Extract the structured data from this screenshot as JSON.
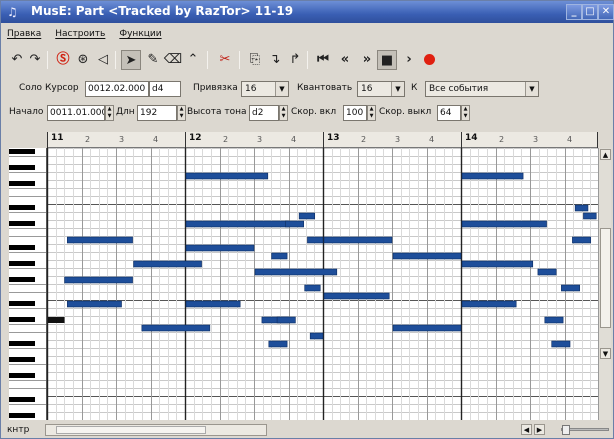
{
  "window": {
    "title": "MusE: Part <Tracked by RazTor> 11-19"
  },
  "menu": {
    "items": [
      "Правка",
      "Настроить",
      "Функции"
    ]
  },
  "toolbar": {
    "undo_icon": "undo-icon",
    "redo_icon": "redo-icon",
    "record_color": "#e02010"
  },
  "params": {
    "solo_label": "Соло",
    "cursor_label": "Курсор",
    "cursor_value": "0012.02.000",
    "cursor_note": "d4",
    "snap_label": "Привязка",
    "snap_value": "16",
    "quant_label": "Квантовать",
    "quant_value": "16",
    "k_label": "К",
    "events_value": "Все события",
    "start_label": "Начало",
    "start_value": "0011.01.000",
    "len_label": "Длн",
    "len_value": "192",
    "pitch_label": "Высота тона",
    "pitch_value": "d2",
    "velon_label": "Скор. вкл",
    "velon_value": "100",
    "veloff_label": "Скор. выкл",
    "veloff_value": "64"
  },
  "ruler": {
    "bars": [
      "11",
      "12",
      "13",
      "14",
      "1"
    ],
    "beats": [
      "2",
      "3",
      "4"
    ]
  },
  "notes": {
    "color": "#1e4e9a",
    "items": [
      {
        "t": 0.14,
        "d": 0.48,
        "p": 22
      },
      {
        "t": 0.62,
        "d": 0.5,
        "p": 19
      },
      {
        "t": 0.12,
        "d": 0.5,
        "p": 17
      },
      {
        "t": 0.14,
        "d": 0.4,
        "p": 14
      },
      {
        "t": 0.68,
        "d": 0.5,
        "p": 11
      },
      {
        "t": 1.0,
        "d": 0.6,
        "p": 30
      },
      {
        "t": 1.0,
        "d": 0.75,
        "p": 24
      },
      {
        "t": 1.0,
        "d": 0.5,
        "p": 21
      },
      {
        "t": 1.5,
        "d": 0.6,
        "p": 18
      },
      {
        "t": 1.0,
        "d": 0.4,
        "p": 14
      },
      {
        "t": 1.55,
        "d": 0.2,
        "p": 12
      },
      {
        "t": 1.6,
        "d": 0.14,
        "p": 9
      },
      {
        "t": 1.72,
        "d": 0.14,
        "p": 24
      },
      {
        "t": 1.82,
        "d": 0.12,
        "p": 25
      },
      {
        "t": 1.88,
        "d": 0.12,
        "p": 22
      },
      {
        "t": 1.62,
        "d": 0.12,
        "p": 20
      },
      {
        "t": 1.86,
        "d": 0.12,
        "p": 16
      },
      {
        "t": 1.66,
        "d": 0.14,
        "p": 12
      },
      {
        "t": 1.9,
        "d": 0.1,
        "p": 10
      },
      {
        "t": 2.0,
        "d": 0.5,
        "p": 22
      },
      {
        "t": 2.5,
        "d": 0.5,
        "p": 20
      },
      {
        "t": 2.0,
        "d": 0.48,
        "p": 15
      },
      {
        "t": 2.5,
        "d": 0.5,
        "p": 11
      },
      {
        "t": 3.0,
        "d": 0.45,
        "p": 30
      },
      {
        "t": 3.0,
        "d": 0.62,
        "p": 24
      },
      {
        "t": 3.0,
        "d": 0.52,
        "p": 19
      },
      {
        "t": 3.55,
        "d": 0.14,
        "p": 18
      },
      {
        "t": 3.0,
        "d": 0.4,
        "p": 14
      },
      {
        "t": 3.6,
        "d": 0.14,
        "p": 12
      },
      {
        "t": 3.65,
        "d": 0.14,
        "p": 9
      },
      {
        "t": 3.72,
        "d": 0.14,
        "p": 16
      },
      {
        "t": 3.8,
        "d": 0.14,
        "p": 22
      },
      {
        "t": 3.82,
        "d": 0.1,
        "p": 26
      },
      {
        "t": 3.88,
        "d": 0.1,
        "p": 25
      }
    ]
  },
  "selected_note": {
    "t": 0.0,
    "d": 0.12,
    "p": 12
  },
  "status": {
    "ctrl_label": "кнтр"
  }
}
